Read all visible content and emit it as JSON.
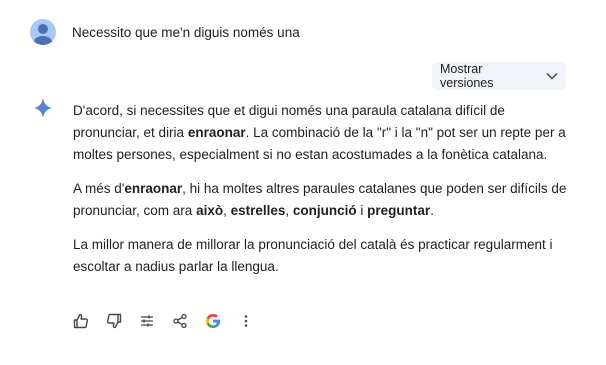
{
  "user": {
    "message": "Necessito que me'n diguis només una",
    "avatar_icon": "user-avatar-icon"
  },
  "versions_button": {
    "label": "Mostrar versiones",
    "icon": "chevron-down-icon"
  },
  "response": {
    "icon": "gemini-sparkle-icon",
    "p1": {
      "t1": "D'acord, si necessites que et digui només una paraula catalana difícil de pronunciar, et diria ",
      "b1": "enraonar",
      "t2": ". La combinació de la \"r\" i la \"n\" pot ser un repte per a moltes persones, especialment si no estan acostumades a la fonètica catalana."
    },
    "p2": {
      "t1": "A més d'",
      "b1": "enraonar",
      "t2": ", hi ha moltes altres paraules catalanes que poden ser difícils de pronunciar, com ara ",
      "b2": "això",
      "t3": ", ",
      "b3": "estrelles",
      "t4": ", ",
      "b4": "conjunció",
      "t5": " i ",
      "b5": "preguntar",
      "t6": "."
    },
    "p3": {
      "t1": "La millor manera de millorar la pronunciació del català és practicar regularment i escoltar a nadius parlar la llengua."
    }
  },
  "actions": [
    "thumbs-up-icon",
    "thumbs-down-icon",
    "tune-icon",
    "share-icon",
    "google-icon",
    "more-vert-icon"
  ],
  "colors": {
    "avatar": "#a8c7fa",
    "button_bg": "#f0f4f9",
    "text": "#1f1f1f",
    "icon": "#444746"
  }
}
